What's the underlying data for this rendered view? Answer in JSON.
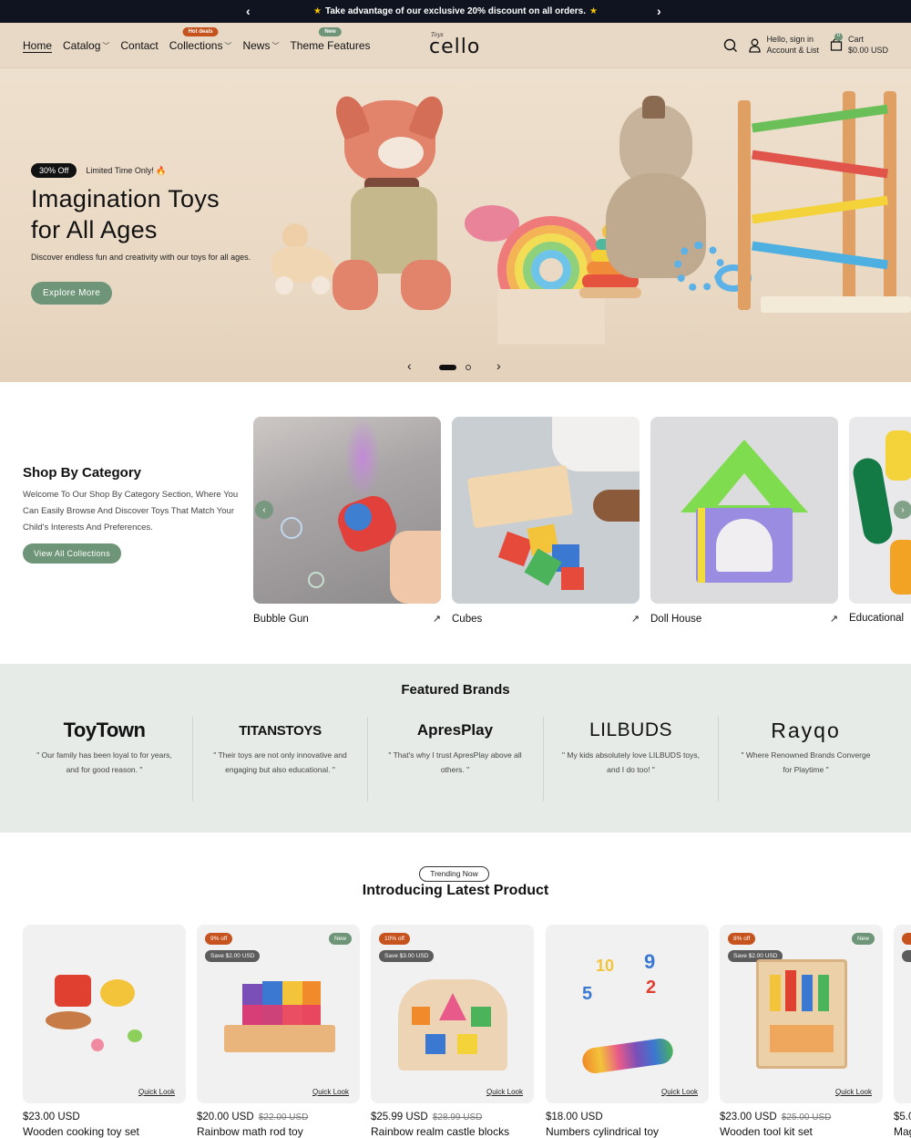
{
  "announcement": {
    "text": "Take advantage of our exclusive 20% discount on all orders.",
    "star": "★",
    "prev": "‹",
    "next": "›"
  },
  "header": {
    "nav": [
      {
        "label": "Home",
        "active": true,
        "dropdown": false
      },
      {
        "label": "Catalog",
        "dropdown": true
      },
      {
        "label": "Contact",
        "dropdown": false
      },
      {
        "label": "Collections",
        "dropdown": true,
        "badge": "Hot deals"
      },
      {
        "label": "News",
        "dropdown": true
      },
      {
        "label": "Theme Features",
        "dropdown": false,
        "badge": "New"
      }
    ],
    "chevron": "⌄",
    "logo": {
      "tagline": "Toys",
      "name": "cello"
    },
    "account": {
      "line1": "Hello, sign in",
      "line2": "Account & List"
    },
    "cart": {
      "label": "Cart",
      "total": "$0.00 USD",
      "count": "0"
    }
  },
  "hero": {
    "badge": "30% Off",
    "limited": "Limited Time Only! 🔥",
    "title_line1": "Imagination Toys",
    "title_line2": "for All Ages",
    "subtitle": "Discover endless fun and creativity with our toys for all ages.",
    "cta": "Explore More",
    "prev": "‹",
    "next": "›",
    "slide_count": 2,
    "active_slide": 1
  },
  "categories": {
    "title": "Shop By Category",
    "description": "Welcome To Our Shop By Category Section, Where You Can Easily Browse And Discover Toys That Match Your Child's Interests And Preferences.",
    "cta": "View All Collections",
    "arrow": "↗",
    "prev": "‹",
    "next": "›",
    "items": [
      {
        "label": "Bubble Gun"
      },
      {
        "label": "Cubes"
      },
      {
        "label": "Doll House"
      },
      {
        "label": "Educational"
      }
    ]
  },
  "brands": {
    "title": "Featured Brands",
    "items": [
      {
        "name": "ToyTown",
        "quote": "\" Our family has been loyal to for years, and for good reason. \""
      },
      {
        "name": "TITANSTOYS",
        "quote": "\" Their toys are not only innovative and engaging but also educational. \""
      },
      {
        "name": "ApresPlay",
        "quote": "\" That's why I trust ApresPlay above all others. \""
      },
      {
        "name": "LILBUDS",
        "quote": "\" My kids absolutely love LILBUDS toys, and I do too! \""
      },
      {
        "name": "Rayqo",
        "quote": "\" Where Renowned Brands Converge for Playtime \""
      }
    ]
  },
  "products": {
    "pill": "Trending Now",
    "title": "Introducing Latest Product",
    "quick_look": "Quick Look",
    "items": [
      {
        "name": "Wooden cooking toy set",
        "price": "$23.00 USD",
        "old_price": "",
        "off": "",
        "save": "",
        "new": ""
      },
      {
        "name": "Rainbow math rod toy",
        "price": "$20.00 USD",
        "old_price": "$22.00 USD",
        "off": "9% off",
        "save": "Save $2.00 USD",
        "new": "New"
      },
      {
        "name": "Rainbow realm castle blocks",
        "price": "$25.99 USD",
        "old_price": "$28.99 USD",
        "off": "10% off",
        "save": "Save $3.00 USD",
        "new": ""
      },
      {
        "name": "Numbers cylindrical toy",
        "price": "$18.00 USD",
        "old_price": "",
        "off": "",
        "save": "",
        "new": ""
      },
      {
        "name": "Wooden tool kit set",
        "price": "$23.00 USD",
        "old_price": "$25.00 USD",
        "off": "8% off",
        "save": "Save $2.00 USD",
        "new": "New"
      },
      {
        "name": "Mag",
        "price": "$5.0",
        "old_price": "",
        "off": "",
        "save": "",
        "new": ""
      }
    ]
  },
  "colors": {
    "accent_green": "#6e9578",
    "hot_orange": "#c6531d",
    "announce_bg": "#0f1420",
    "header_bg": "#e8d9c7",
    "brands_bg": "#e6ebe7"
  }
}
